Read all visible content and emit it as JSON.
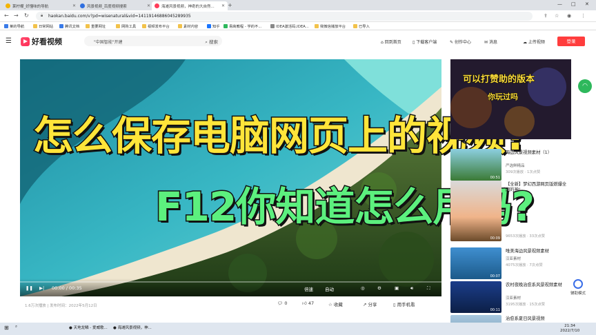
{
  "browser": {
    "tabs": [
      {
        "title": "莱柠檬_好懂味的导航",
        "color": "#f4b400"
      },
      {
        "title": "风景视频_百度视频搜索",
        "color": "#2f6fe0"
      },
      {
        "title": "海滩风景视频，神奇的大自然...",
        "color": "#ff3d5a"
      }
    ],
    "new_tab": "+",
    "url": "haokan.baidu.com/v?pd=wisenatural&vid=14119146886045289935",
    "bookmarks": [
      "莱的导航",
      "日常网站",
      "腾讯文档",
      "重要网址",
      "网购工具",
      "视频发布平台",
      "素材内容",
      "知乎",
      "易高教程 - 学的不...",
      "IDEA激活码,IDEA...",
      "我微信播放平台",
      "已导入"
    ]
  },
  "site": {
    "logo": "好看视频",
    "search_placeholder": "\"中国智能\"开建",
    "search_button": "搜索",
    "header_links": [
      "回到首页",
      "下载客户端",
      "创作中心",
      "消息",
      "上传视频"
    ],
    "login": "登录"
  },
  "video": {
    "overlay_title_1": "怎么保存电脑网页上的视频?",
    "overlay_title_2": "F12你知道怎么用吗?",
    "time": "00:00 / 00:35",
    "speed": "倍速",
    "quality": "自动",
    "progress": 0.0
  },
  "meta": {
    "plays_date": "1.6万次播放 | 发布时间：2022年5月12日",
    "comments": "0",
    "likes": "47",
    "collect": "收藏",
    "share": "分享",
    "phone": "用手机看"
  },
  "sidebar": {
    "ad": {
      "line1": "可以打赞助的版本",
      "line2": "你玩过吗"
    },
    "items": [
      {
        "title": "海边风景视频素材（1）",
        "author": "严选鲜精品",
        "plays": "309次播放 · 1次点赞",
        "duration": "00:51"
      },
      {
        "title": "【全新】梦幻西游网页版燃爆全网的神!",
        "author": "",
        "plays": "9653次播放 · 33次点赞",
        "duration": "00:09"
      },
      {
        "title": "唯美海边风景视频素材",
        "author": "汉亚素材",
        "plays": "4075次播放 · 7次点赞",
        "duration": "00:07"
      },
      {
        "title": "农村夜晚治愈系风景视频素材",
        "author": "汉亚素材",
        "plays": "3195次播放 · 15次点赞",
        "duration": "00:11"
      },
      {
        "title": "治愈系夏日风景视频",
        "author": "",
        "plays": "",
        "duration": ""
      }
    ],
    "assist": "辅助模式"
  },
  "taskbar": {
    "items": [
      "天地龙鳞 - 爱威歌...",
      "海滩风景视频，神..."
    ],
    "time": "21:34",
    "date": "2022/7/10"
  },
  "colors": {
    "accent": "#ff3d3d",
    "brand": "#ff2d55"
  }
}
